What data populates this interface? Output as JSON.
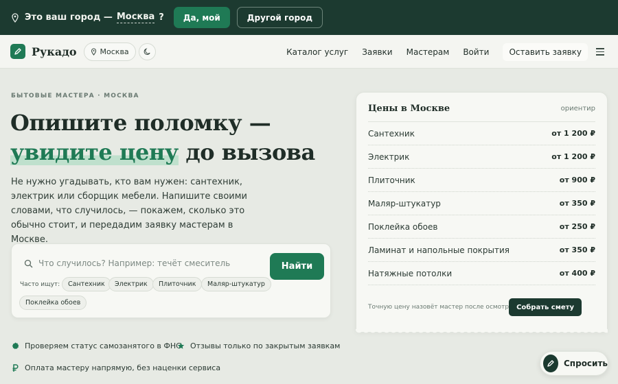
{
  "city_bar": {
    "question": "Это ваш город —",
    "city": "Москва",
    "question_mark": "?",
    "yes_label": "Да, мой",
    "other_label": "Другой город"
  },
  "nav": {
    "brand": "Рукадо",
    "city": "Москва",
    "links": [
      "Каталог услуг",
      "Заявки",
      "Мастерам",
      "Войти"
    ],
    "cta": "Оставить заявку"
  },
  "hero": {
    "eyebrow": "БЫТОВЫЕ МАСТЕРА · МОСКВА",
    "title_line1": "Опишите поломку —",
    "title_highlight": "увидите цену",
    "title_rest": " до вызова",
    "lead": "Не нужно угадывать, кто вам нужен: сантехник, электрик или сборщик мебели. Напишите своими словами, что случилось, — покажем, сколько это обычно стоит, и передадим заявку мастерам в Москве."
  },
  "search": {
    "placeholder": "Что случилось? Например: течёт смеситель",
    "button": "Найти",
    "chips_label": "Часто ищут:",
    "chips": [
      "Сантехник",
      "Электрик",
      "Плиточник",
      "Маляр-штукатур",
      "Поклейка обоев"
    ]
  },
  "features": [
    "Проверяем статус самозанятого в ФНС",
    "Отзывы только по закрытым заявкам",
    "Оплата мастеру напрямую, без наценки сервиса"
  ],
  "prices": {
    "title": "Цены в Москве",
    "hint": "ориентир",
    "rows": [
      {
        "name": "Сантехник",
        "value": "от 1 200 ₽"
      },
      {
        "name": "Электрик",
        "value": "от 1 200 ₽"
      },
      {
        "name": "Плиточник",
        "value": "от 900 ₽"
      },
      {
        "name": "Маляр-штукатур",
        "value": "от 350 ₽"
      },
      {
        "name": "Поклейка обоев",
        "value": "от 250 ₽"
      },
      {
        "name": "Ламинат и напольные покрытия",
        "value": "от 350 ₽"
      },
      {
        "name": "Натяжные потолки",
        "value": "от 400 ₽"
      }
    ],
    "note": "Точную цену назовёт мастер после осмотра",
    "button": "Собрать смету"
  },
  "ask_button": "Спросить",
  "colors": {
    "accent": "#1f7a55",
    "dark": "#1c3a30",
    "background": "#e7eae4"
  }
}
